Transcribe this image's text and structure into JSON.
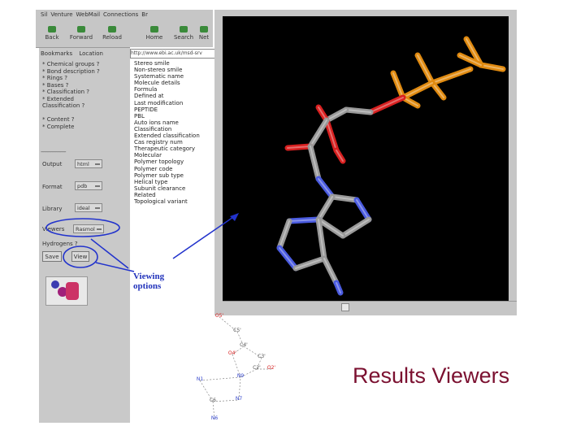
{
  "menu": [
    "Sil",
    "Venture",
    "WebMail",
    "Connections",
    "Br"
  ],
  "toolbar": {
    "back": "Back",
    "forward": "Forward",
    "reload": "Reload",
    "home": "Home",
    "search": "Search",
    "net": "Net"
  },
  "bookmarks_label": "Bookmarks",
  "location_label": "Location",
  "url": "http://www.ebi.ac.uk/msd-srv",
  "options": [
    "* Chemical groups ?",
    "* Bond description ?",
    "* Rings ?",
    "* Bases ?",
    "* Classification ?",
    "* Extended",
    "  Classification ?",
    "",
    "* Content ?",
    "* Complete"
  ],
  "separator": "--------------------",
  "form": {
    "output_label": "Output",
    "output_value": "html",
    "format_label": "Format",
    "format_value": "pdb",
    "library_label": "Library",
    "library_value": "ideal",
    "viewer_label": "Viewers",
    "viewer_value": "Rasmol",
    "hydrogens_label": "Hydrogens ?",
    "save_button": "Save",
    "view_button": "View"
  },
  "results_list": [
    "Stereo smile",
    "Non-stereo smile",
    "Systematic name",
    "Molecule details",
    "Formula",
    "Defined at",
    "Last modification",
    "PEPTIDE",
    "PBL",
    "Auto ions name",
    "Classification",
    "Extended classification",
    "Cas registry num",
    "Therapeutic category",
    "Molecular",
    "Polymer topology",
    "Polymer code",
    "Polymer sub type",
    "Helical type",
    "Subunit clearance",
    "Related",
    "Topological variant"
  ],
  "schematic_labels": [
    "O5'",
    "C5'",
    "C4'",
    "N9",
    "O4'",
    "C3'",
    "C2'",
    "O2'",
    "N1",
    "C6",
    "N7",
    "N6"
  ],
  "annotation_viewing": "Viewing",
  "annotation_options": "options",
  "slide_title": "Results Viewers",
  "colors": {
    "title": "#7b1030",
    "annotation": "#2233bb",
    "viewer_bg": "#000000"
  }
}
